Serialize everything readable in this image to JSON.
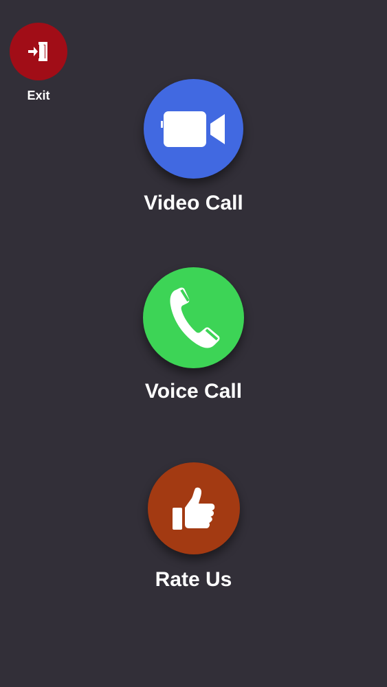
{
  "colors": {
    "background": "#322f38",
    "exit": "#a10d17",
    "video": "#4169e1",
    "voice": "#3dd456",
    "rate": "#a33a12"
  },
  "exit": {
    "label": "Exit",
    "icon": "exit-door-icon"
  },
  "actions": [
    {
      "id": "video",
      "label": "Video Call",
      "icon": "video-camera-icon"
    },
    {
      "id": "voice",
      "label": "Voice Call",
      "icon": "phone-icon"
    },
    {
      "id": "rate",
      "label": "Rate Us",
      "icon": "thumbs-up-icon"
    }
  ]
}
